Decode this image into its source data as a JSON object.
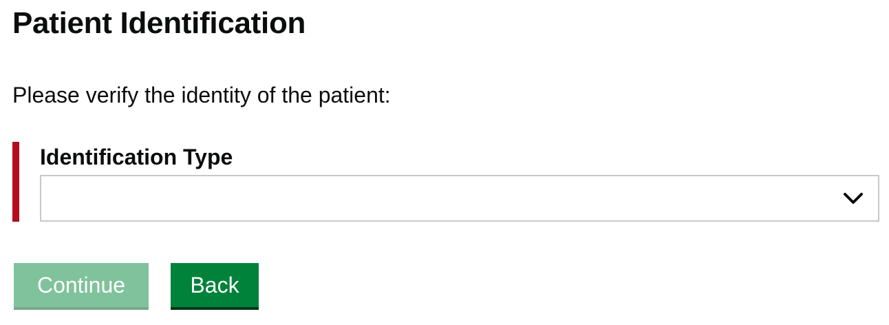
{
  "page": {
    "title": "Patient Identification",
    "instruction": "Please verify the identity of the patient:"
  },
  "form": {
    "identification_type": {
      "label": "Identification Type",
      "selected_value": "",
      "error": true
    }
  },
  "actions": {
    "continue_label": "Continue",
    "back_label": "Back"
  },
  "colors": {
    "error_bar": "#b10e1e",
    "continue_disabled": "#80c29b",
    "back_primary": "#00823b",
    "text": "#0b0c0c"
  },
  "icons": {
    "select_indicator": "chevron-down-icon"
  }
}
